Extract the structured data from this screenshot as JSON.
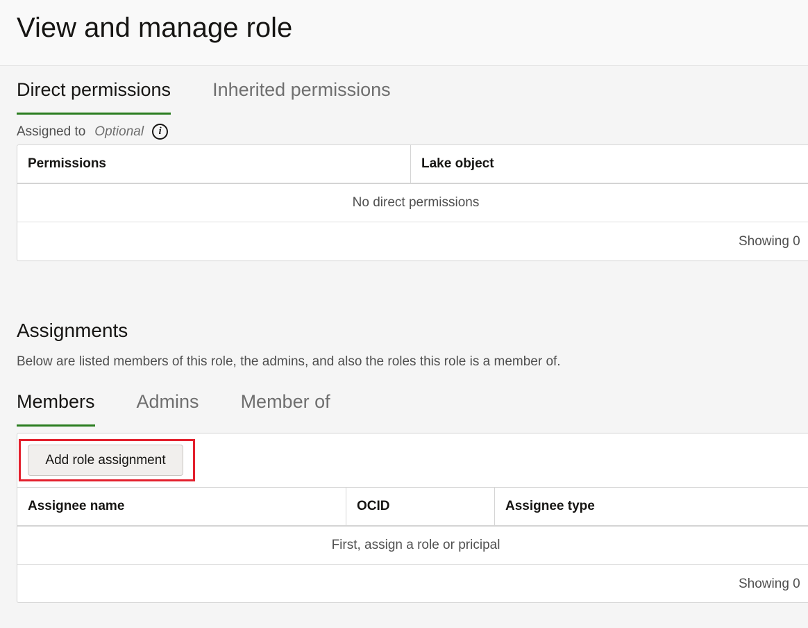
{
  "page": {
    "title": "View and manage role"
  },
  "permission_tabs": [
    {
      "label": "Direct permissions",
      "active": true
    },
    {
      "label": "Inherited permissions",
      "active": false
    }
  ],
  "assigned_to": {
    "label": "Assigned to",
    "optional": "Optional",
    "icon": "info-icon"
  },
  "permissions_table": {
    "columns": [
      "Permissions",
      "Lake object"
    ],
    "empty_message": "No direct permissions",
    "footer": "Showing 0"
  },
  "assignments": {
    "title": "Assignments",
    "description": "Below are listed members of this role, the admins, and also the roles this role is a member of.",
    "tabs": [
      {
        "label": "Members",
        "active": true
      },
      {
        "label": "Admins",
        "active": false
      },
      {
        "label": "Member of",
        "active": false
      }
    ],
    "add_button": "Add role assignment",
    "table": {
      "columns": [
        "Assignee name",
        "OCID",
        "Assignee type"
      ],
      "empty_message": "First, assign a role or pricipal",
      "footer": "Showing 0"
    }
  },
  "colors": {
    "accent": "#2a7d1f",
    "highlight": "#e3202d"
  }
}
